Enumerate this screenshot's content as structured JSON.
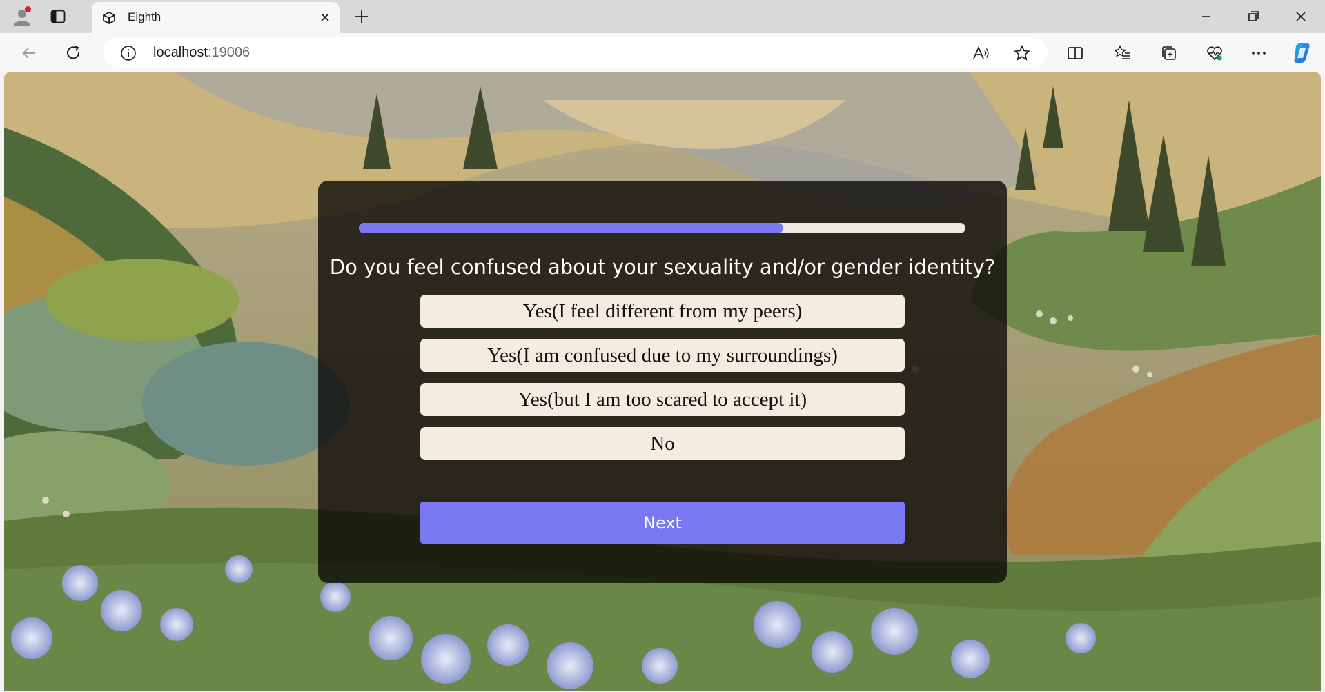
{
  "browser": {
    "tab_title": "Eighth",
    "url_host": "localhost",
    "url_port": ":19006"
  },
  "quiz": {
    "progress_fraction": 0.7,
    "question": "Do you feel confused about your sexuality and/or gender identity?",
    "options": [
      "Yes(I feel different from my peers)",
      "Yes(I am confused due to my surroundings)",
      "Yes(but I am too scared to accept it)",
      "No"
    ],
    "next_label": "Next"
  },
  "colors": {
    "accent": "#7a78f2",
    "option_bg": "#f5ece1",
    "progress_track": "#efe9e0"
  }
}
